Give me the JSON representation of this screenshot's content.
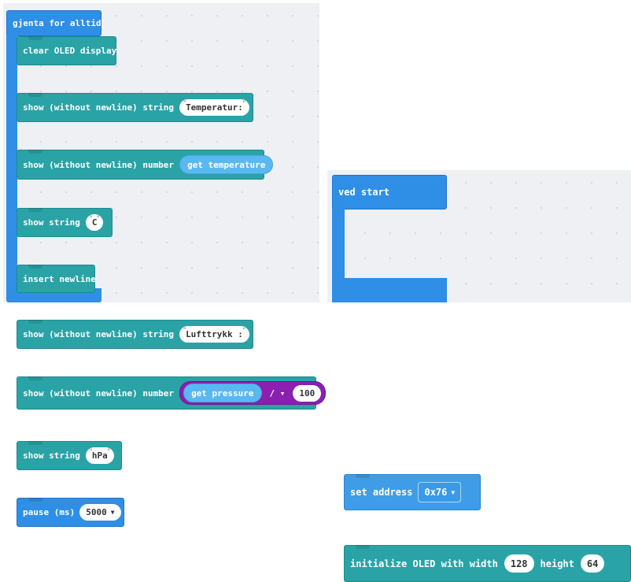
{
  "forever_block": {
    "header": "gjenta for alltid",
    "blocks": {
      "clear": "clear OLED display",
      "show_string_nl_1": "show (without newline) string",
      "temperatur_str": "Temperatur:",
      "show_number_nl_1": "show (without newline) number",
      "get_temperature": "get temperature",
      "show_string_1": "show string",
      "c_str": "C",
      "insert_newline": "insert newline",
      "show_string_nl_2": "show (without newline) string",
      "lufttrykk_str": "Lufttrykk :",
      "show_number_nl_2": "show (without newline) number",
      "get_pressure": "get pressure",
      "div_op": "/ ▾",
      "divisor": "100",
      "show_string_2": "show string",
      "hpa_str": "hPa",
      "pause": "pause (ms)",
      "pause_value": "5000"
    }
  },
  "start_block": {
    "header": "ved start",
    "set_address": "set address",
    "address_value": "0x76",
    "init_oled": "initialize OLED with width",
    "width_value": "128",
    "height_label": "height",
    "height_value": "64"
  },
  "icons": {
    "dropdown": "caret-down-icon"
  },
  "colors": {
    "event_block": "#2f8fe6",
    "oled_block": "#2aa3a6",
    "reporter": "#5ab8f0",
    "math_block": "#8a1fb0",
    "workspace": "#eef0f3"
  }
}
